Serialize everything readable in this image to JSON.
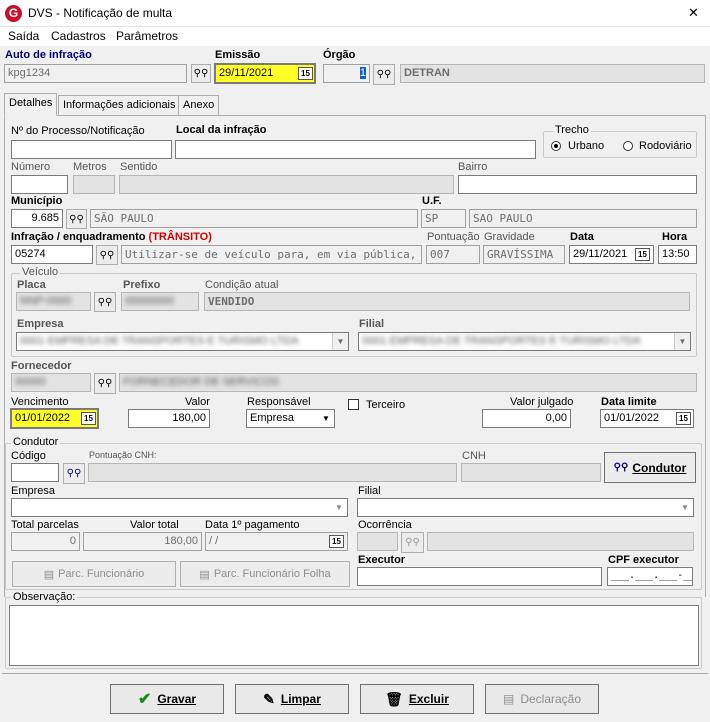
{
  "window": {
    "title": "DVS - Notificação de multa",
    "close": "✕"
  },
  "menu": [
    "Saída",
    "Cadastros",
    "Parâmetros"
  ],
  "header": {
    "auto_label": "Auto de infração",
    "auto_value": "kpg1234",
    "emissao_label": "Emissão",
    "emissao_value": "29/11/2021",
    "orgao_label": "Órgão",
    "orgao_code": "1",
    "orgao_name": "DETRAN"
  },
  "tabs": [
    "Detalhes",
    "Informações adicionais",
    "Anexo"
  ],
  "detalhes": {
    "processo_label": "Nº do Processo/Notificação",
    "processo_value": "",
    "local_label": "Local da infração",
    "local_value": "",
    "trecho_label": "Trecho",
    "urbano": "Urbano",
    "rodoviario": "Rodoviário",
    "numero_label": "Número",
    "metros_label": "Metros",
    "sentido_label": "Sentido",
    "bairro_label": "Bairro",
    "municipio_label": "Município",
    "municipio_code": "9.685",
    "municipio_name": "SÃO PAULO",
    "uf_label": "U.F.",
    "uf_code": "SP",
    "uf_name": "SAO PAULO",
    "infracao_label": "Infração / enquadramento",
    "infracao_sub": "(TRÂNSITO)",
    "infracao_code": "05274",
    "infracao_desc": "Utilizar-se de veículo para, em via pública, demonstr",
    "pontuacao_label": "Pontuação",
    "pontuacao_value": "007",
    "gravidade_label": "Gravidade",
    "gravidade_value": "GRAVÍSSIMA",
    "data_label": "Data",
    "data_value": "29/11/2021",
    "hora_label": "Hora",
    "hora_value": "13:50",
    "veiculo_label": "Veículo",
    "placa_label": "Placa",
    "placa_value": "NNP-0000",
    "prefixo_label": "Prefixo",
    "prefixo_value": "00000000",
    "condicao_label": "Condição atual",
    "condicao_value": "VENDIDO",
    "empresa_label": "Empresa",
    "empresa_value": "0001 EMPRESA DE TRANSPORTES E TURISMO LTDA",
    "filial_label": "Filial",
    "filial_value": "0001 EMPRESA DE TRANSPORTES E TURISMO LTDA",
    "fornecedor_label": "Fornecedor",
    "fornecedor_code": "00000",
    "fornecedor_name": "FORNECEDOR DE SERVICOS",
    "vencimento_label": "Vencimento",
    "vencimento_value": "01/01/2022",
    "valor_label": "Valor",
    "valor_value": "180,00",
    "responsavel_label": "Responsável",
    "responsavel_value": "Empresa",
    "terceiro_label": "Terceiro",
    "valor_julgado_label": "Valor julgado",
    "valor_julgado_value": "0,00",
    "data_limite_label": "Data limite",
    "data_limite_value": "01/01/2022"
  },
  "condutor": {
    "group_label": "Condutor",
    "codigo_label": "Código",
    "pontuacao_cnh_label": "Pontuação CNH:",
    "cnh_label": "CNH",
    "condutor_button": "Condutor",
    "empresa_label": "Empresa",
    "filial_label": "Filial",
    "total_parcelas_label": "Total parcelas",
    "total_parcelas_value": "0",
    "valor_total_label": "Valor total",
    "valor_total_value": "180,00",
    "data_pag_label": "Data 1º pagamento",
    "data_pag_value": " / /",
    "ocorrencia_label": "Ocorrência",
    "parc_func_button": "Parc. Funcionário",
    "parc_func_folha_button": "Parc. Funcionário Folha",
    "executor_label": "Executor",
    "cpf_executor_label": "CPF executor",
    "cpf_executor_value": "___.___.___-__"
  },
  "observacao_label": "Observação:",
  "buttons": {
    "gravar": "Gravar",
    "limpar": "Limpar",
    "excluir": "Excluir",
    "declaracao": "Declaração"
  },
  "calendar_glyph": "15",
  "binoculars_glyph": "⛳",
  "colors": {
    "highlight": "#ffff28",
    "navy": "#00007a",
    "red": "#d00000",
    "app_icon": "#c8102e"
  }
}
